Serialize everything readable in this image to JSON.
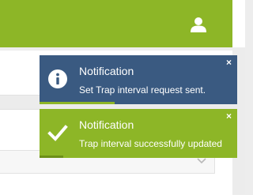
{
  "colors": {
    "brand_green": "#8db627",
    "info_blue": "#3a5a81"
  },
  "topbar": {
    "user_icon": "user-icon"
  },
  "notifications": [
    {
      "type": "info",
      "icon": "info-icon",
      "title": "Notification",
      "message": "Set Trap interval request sent.",
      "close_label": "×",
      "progress": 0.38
    },
    {
      "type": "success",
      "icon": "check-icon",
      "title": "Notification",
      "message": "Trap interval successfully updated",
      "close_label": "×",
      "progress": 0.12
    }
  ]
}
